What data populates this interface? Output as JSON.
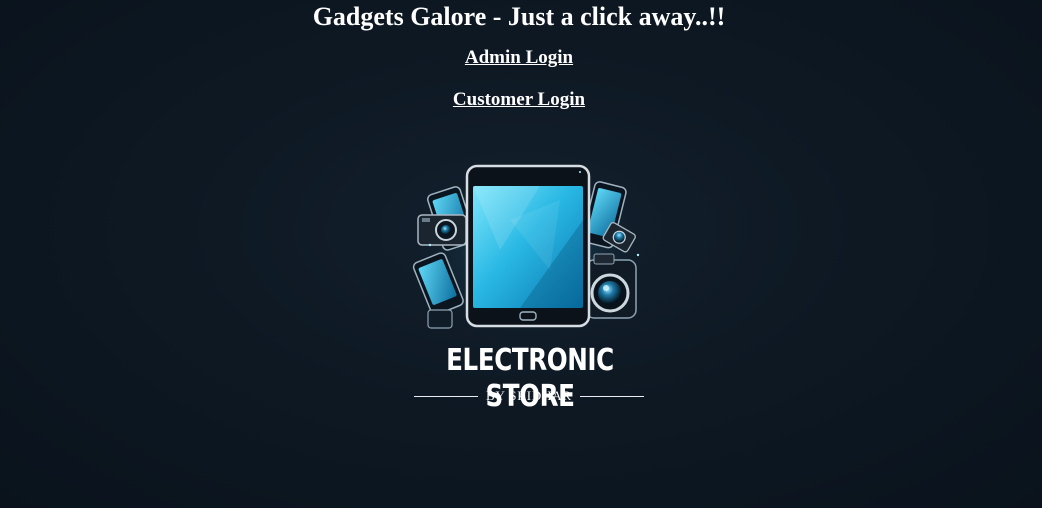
{
  "header": {
    "title": "Gadgets Galore - Just a click away..!!"
  },
  "nav": {
    "admin_login": "Admin Login",
    "customer_login": "Customer Login"
  },
  "logo": {
    "name": "ELECTRONIC STORE",
    "byline": "BY SRIDHAR",
    "accent_color": "#28c0e8",
    "icons": [
      "tablet-icon",
      "phone-icon",
      "camera-icon"
    ]
  }
}
